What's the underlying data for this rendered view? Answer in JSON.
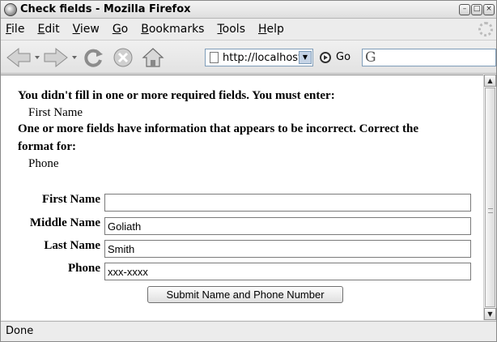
{
  "window": {
    "title": "Check fields - Mozilla Firefox"
  },
  "menu": [
    {
      "label": "File",
      "accel": "F",
      "rest": "ile"
    },
    {
      "label": "Edit",
      "accel": "E",
      "rest": "dit"
    },
    {
      "label": "View",
      "accel": "V",
      "rest": "iew"
    },
    {
      "label": "Go",
      "accel": "G",
      "rest": "o"
    },
    {
      "label": "Bookmarks",
      "accel": "B",
      "rest": "ookmarks"
    },
    {
      "label": "Tools",
      "accel": "T",
      "rest": "ools"
    },
    {
      "label": "Help",
      "accel": "H",
      "rest": "elp"
    }
  ],
  "toolbar": {
    "url": "http://localhost/F",
    "go_label": "Go",
    "search_logo": "G",
    "icons": [
      "back-icon",
      "forward-icon",
      "reload-icon",
      "stop-icon",
      "home-icon"
    ]
  },
  "page": {
    "required_msg": "You didn't fill in one or more required fields. You must enter:",
    "required_items": [
      "First Name"
    ],
    "format_msg_line1": "One or more fields have information that appears to be incorrect. Correct the",
    "format_msg_line2": "format for:",
    "format_items": [
      "Phone"
    ]
  },
  "form": {
    "fields": [
      {
        "label": "First Name",
        "value": ""
      },
      {
        "label": "Middle Name",
        "value": "Goliath"
      },
      {
        "label": "Last Name",
        "value": "Smith"
      },
      {
        "label": "Phone",
        "value": "xxx-xxxx"
      }
    ],
    "submit_label": "Submit Name and Phone Number"
  },
  "status": {
    "text": "Done"
  }
}
